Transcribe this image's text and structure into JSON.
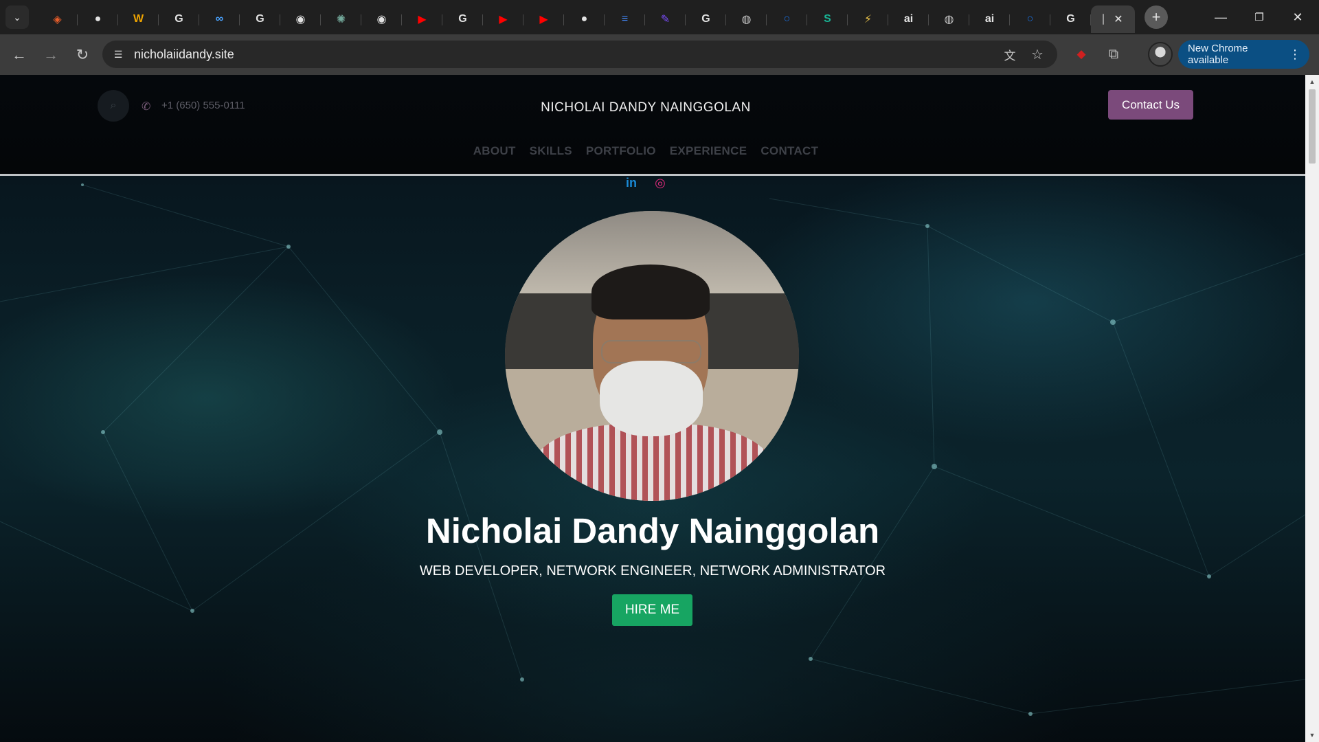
{
  "browser": {
    "tabs": [
      {
        "icon": "brave-shield-icon",
        "color": "#e85d2a"
      },
      {
        "icon": "github-icon",
        "color": "#e3e3e3"
      },
      {
        "icon": "iw-icon",
        "color": "#f0a500"
      },
      {
        "icon": "google-icon",
        "color": "#e3e3e3"
      },
      {
        "icon": "dp-icon",
        "color": "#4aa3ff"
      },
      {
        "icon": "google-icon",
        "color": "#e3e3e3"
      },
      {
        "icon": "chrome-icon",
        "color": "#e3e3e3"
      },
      {
        "icon": "chatgpt-icon",
        "color": "#74aa9c"
      },
      {
        "icon": "chrome-icon",
        "color": "#e3e3e3"
      },
      {
        "icon": "youtube-icon",
        "color": "#ff0000"
      },
      {
        "icon": "google-icon",
        "color": "#e3e3e3"
      },
      {
        "icon": "youtube-icon",
        "color": "#ff0000"
      },
      {
        "icon": "youtube-icon",
        "color": "#ff0000"
      },
      {
        "icon": "github-icon",
        "color": "#e3e3e3"
      },
      {
        "icon": "docs-icon",
        "color": "#4285f4"
      },
      {
        "icon": "pen-icon",
        "color": "#7c4dff"
      },
      {
        "icon": "google-icon",
        "color": "#e3e3e3"
      },
      {
        "icon": "globe-icon",
        "color": "#c7c7c7"
      },
      {
        "icon": "ring-icon",
        "color": "#1a73e8"
      },
      {
        "icon": "s-icon",
        "color": "#19b394"
      },
      {
        "icon": "lightning-icon",
        "color": "#f2c94c"
      },
      {
        "icon": "ai-icon",
        "color": "#e3e3e3"
      },
      {
        "icon": "globe-icon",
        "color": "#c7c7c7"
      },
      {
        "icon": "ai-icon",
        "color": "#e3e3e3"
      },
      {
        "icon": "ring-icon",
        "color": "#1a73e8"
      },
      {
        "icon": "google-icon",
        "color": "#e3e3e3"
      }
    ],
    "active_tab_close": "✕",
    "url": "nicholaiidandy.site",
    "update_label": "New Chrome available"
  },
  "header": {
    "phone": "+1 (650) 555-0111",
    "brand": "NICHOLAI DANDY NAINGGOLAN",
    "contact_button": "Contact Us",
    "nav": [
      "ABOUT",
      "SKILLS",
      "PORTFOLIO",
      "EXPERIENCE",
      "CONTACT"
    ]
  },
  "socials": {
    "linkedin": "in",
    "instagram": "◎"
  },
  "hero": {
    "name": "Nicholai Dandy Nainggolan",
    "subtitle": "WEB DEVELOPER, NETWORK ENGINEER, NETWORK ADMINISTRATOR",
    "cta": "HIRE ME"
  },
  "colors": {
    "accent_purple": "#7b4a7b",
    "cta_green": "#17a562",
    "update_blue": "#0b4f83"
  }
}
